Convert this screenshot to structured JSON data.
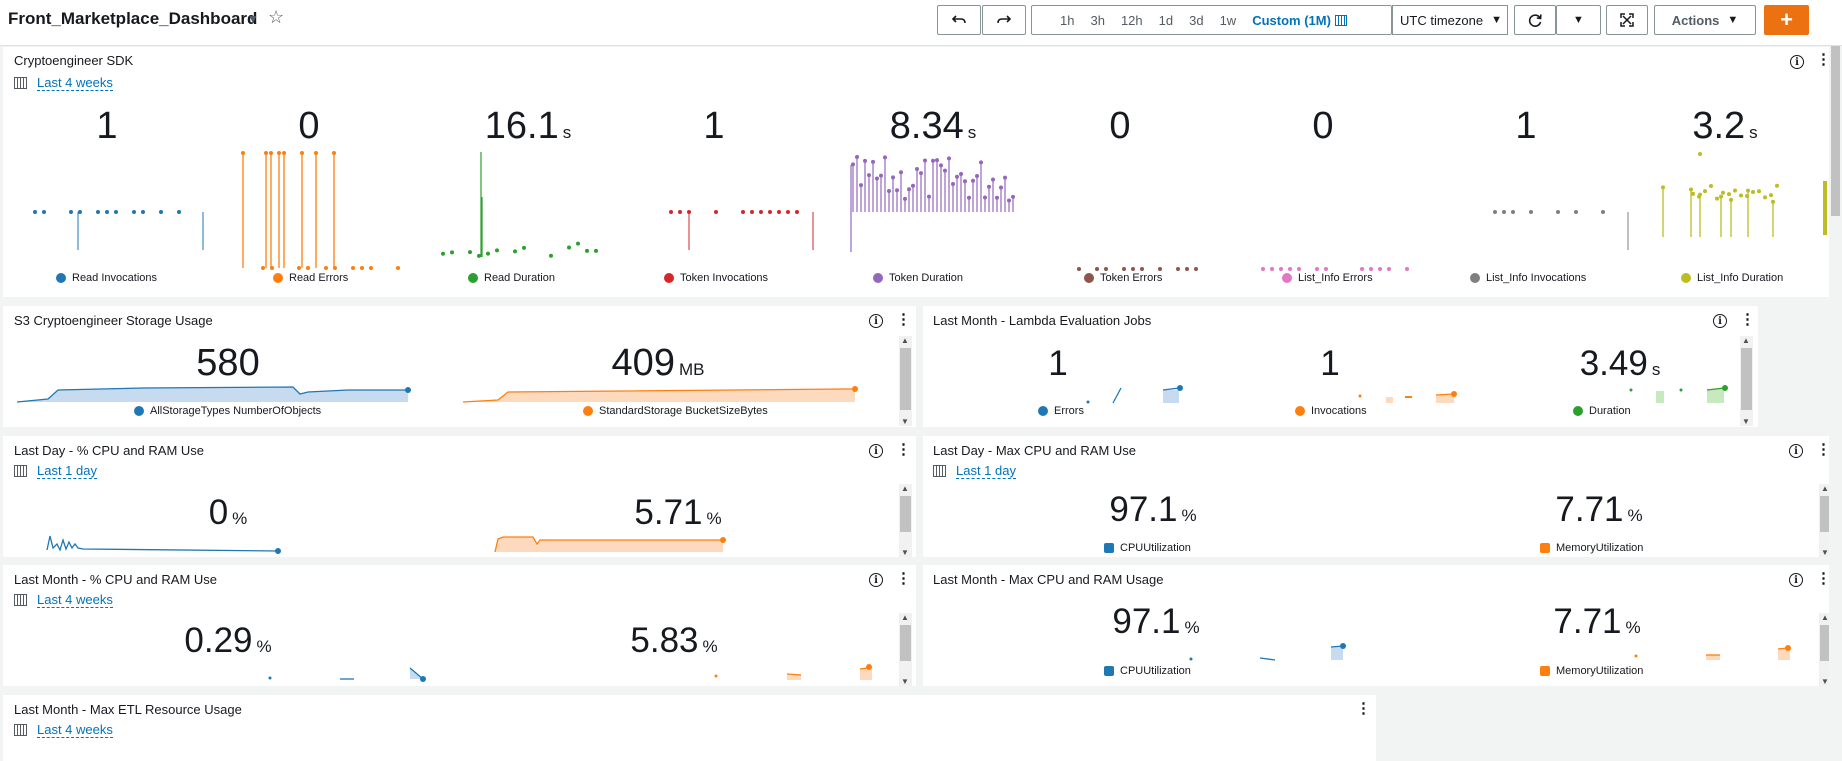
{
  "dashboard": {
    "title": "Front_Marketplace_Dashboard"
  },
  "toolbar": {
    "undo_icon": "undo-icon",
    "redo_icon": "redo-icon",
    "time_ranges": [
      "1h",
      "3h",
      "12h",
      "1d",
      "3d",
      "1w"
    ],
    "custom_range": "Custom (1M)",
    "timezone": "UTC timezone",
    "actions_label": "Actions",
    "add_label": "+"
  },
  "colors": {
    "accent": "#0073bb",
    "orange": "#ec7211"
  },
  "sdk": {
    "title": "Cryptoengineer SDK",
    "period": "Last 4 weeks",
    "metrics": [
      {
        "value": "1",
        "unit": "",
        "label": "Read Invocations",
        "color": "#1f77b4"
      },
      {
        "value": "0",
        "unit": "",
        "label": "Read Errors",
        "color": "#ff7f0e"
      },
      {
        "value": "16.1",
        "unit": "s",
        "label": "Read Duration",
        "color": "#2ca02c"
      },
      {
        "value": "1",
        "unit": "",
        "label": "Token Invocations",
        "color": "#d62728"
      },
      {
        "value": "8.34",
        "unit": "s",
        "label": "Token Duration",
        "color": "#9467bd"
      },
      {
        "value": "0",
        "unit": "",
        "label": "Token Errors",
        "color": "#8c564b"
      },
      {
        "value": "0",
        "unit": "",
        "label": "List_Info Errors",
        "color": "#e377c2"
      },
      {
        "value": "1",
        "unit": "",
        "label": "List_Info Invocations",
        "color": "#7f7f7f"
      },
      {
        "value": "3.2",
        "unit": "s",
        "label": "List_Info Duration",
        "color": "#bcbd22"
      }
    ]
  },
  "s3": {
    "title": "S3 Cryptoengineer Storage Usage",
    "m1": {
      "value": "580",
      "unit": "",
      "label": "AllStorageTypes NumberOfObjects"
    },
    "m2": {
      "value": "409",
      "unit": "MB",
      "label": "StandardStorage BucketSizeBytes"
    }
  },
  "lambda": {
    "title": "Last Month - Lambda Evaluation Jobs",
    "m1": {
      "value": "1",
      "unit": "",
      "label": "Errors"
    },
    "m2": {
      "value": "1",
      "unit": "",
      "label": "Invocations"
    },
    "m3": {
      "value": "3.49",
      "unit": "s",
      "label": "Duration"
    }
  },
  "dayPct": {
    "title": "Last Day - % CPU and RAM Use",
    "period": "Last 1 day",
    "m1": {
      "value": "0",
      "unit": "%"
    },
    "m2": {
      "value": "5.71",
      "unit": "%"
    }
  },
  "dayMax": {
    "title": "Last Day - Max CPU and RAM Use",
    "period": "Last 1 day",
    "m1": {
      "value": "97.1",
      "unit": "%",
      "label": "CPUUtilization"
    },
    "m2": {
      "value": "7.71",
      "unit": "%",
      "label": "MemoryUtilization"
    }
  },
  "monthPct": {
    "title": "Last Month - % CPU and RAM Use",
    "period": "Last 4 weeks",
    "m1": {
      "value": "0.29",
      "unit": "%"
    },
    "m2": {
      "value": "5.83",
      "unit": "%"
    }
  },
  "monthMax": {
    "title": "Last Month - Max CPU and RAM Usage",
    "m1": {
      "value": "97.1",
      "unit": "%",
      "label": "CPUUtilization"
    },
    "m2": {
      "value": "7.71",
      "unit": "%",
      "label": "MemoryUtilization"
    }
  },
  "etl": {
    "title": "Last Month - Max ETL Resource Usage",
    "period": "Last 4 weeks"
  }
}
